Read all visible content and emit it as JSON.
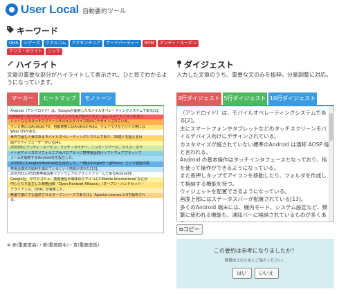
{
  "header": {
    "logo": "User Local",
    "subtitle": "自動要約ツール"
  },
  "keywords": {
    "title": "キーワード",
    "badges": [
      {
        "text": "OHA",
        "color": "blue"
      },
      {
        "text": "シアーズ",
        "color": "blue"
      },
      {
        "text": "クアルコム",
        "color": "blue"
      },
      {
        "text": "アクセンチュア",
        "color": "blue"
      },
      {
        "text": "サードパーティー",
        "color": "blue"
      },
      {
        "text": "ROM",
        "color": "red"
      },
      {
        "text": "アンディ・ルービン",
        "color": "red"
      },
      {
        "text": "クリス・ホワイト",
        "color": "red"
      },
      {
        "text": "ニック",
        "color": "red"
      }
    ]
  },
  "highlight": {
    "title": "ハイライト",
    "desc": "文章の重要な部分がハイライトして表示され、ひと目でわかるようになっています。",
    "tabs": [
      "マーカー",
      "ヒートマップ",
      "モノトーン"
    ],
    "lines": [
      {
        "text": "Android（アンドロイド）は、Googleが開発したモバイルオペレーティングシステムである[2]。",
        "bg": "#ffffff"
      },
      {
        "text": "Linuxカーネルやオープンソースソフトウェアがベースで、主にスマートフォンやタブ",
        "bg": "#ff5c5c"
      },
      {
        "text": "レットなどのタッチスクリーンモバイルデバイス向けにデザインされている。",
        "bg": "#ffb14d"
      },
      {
        "text": "テレビ用にはAndroid TV、自動車用にはAndroid Auto、ウェアラブルデバイス用には",
        "bg": "#ffe37a"
      },
      {
        "text": "Wear OSがある。",
        "bg": "#ffffff"
      },
      {
        "text": "世界で最も人気のあるモバイルオペレーティングシステムであり、20億人を超える月",
        "bg": "#ffd66b"
      },
      {
        "text": "間アクティブユーザーがいる[4]。",
        "bg": "#fff6a6"
      },
      {
        "text": "2003年にアンディ・ルービン、リッチ・マイナー、ニック・シアーズ、クリス・ホワ",
        "bg": "#cfe9a6"
      },
      {
        "text": "イトがアメリカカリフォルニア州パロアルトに携帯電話向けソフトウェアプラットフ",
        "bg": "#8fd0e8"
      },
      {
        "text": "ォームを開発するAndroid社を設立した。",
        "bg": "#a8dcf0"
      },
      {
        "text": "2005年にGoogleがAndroid社を買収した。一時はGoogleが「gPhone」という独自の携",
        "bg": "#64b0e8"
      },
      {
        "text": "帯電話端末の開発を進めているという憶測が流れた[13]。",
        "bg": "#c7e6f5"
      },
      {
        "text": "2007年11月5日携帯電話用ソフトウェアのプラットフォームであるAndroidを、",
        "bg": "#ffffff"
      },
      {
        "text": "Google社、タワクコミュ、技術通信半導体のクアルコムT-Mobile International などが",
        "bg": "#fff2a0"
      },
      {
        "text": "中心となり設立した規格団体「Open Handset Alliance」（オープン・ハンドセット・",
        "bg": "#ffe27a"
      },
      {
        "text": "アライアンス、OHA）が発表した。",
        "bg": "#fff0b0"
      },
      {
        "text": "無償で誰にでも提供されるオープンソースであり[2]、Apache License 2.0で配布され",
        "bg": "#ffd08a"
      },
      {
        "text": "る。",
        "bg": "#ffffff"
      }
    ]
  },
  "digest": {
    "title": "ダイジェスト",
    "desc": "入力した文章のうち、重要な文のみを抜粋。分量調整に対応。",
    "tabs": [
      "3行ダイジェスト",
      "5行ダイジェスト",
      "10行ダイジェスト"
    ],
    "lines": [
      "（アンドロイド）は、モバイルオペレーティングシステムである[2]。",
      "主にスマートフォンやタブレットなどのタッチスクリーンモバイルデバイス向けにデザインされている。",
      "カスタマイズが施されていない標準のAndroid は通称 AOSP 版と言われる。",
      "Android の基本操作はタッチインタフェースとなっており、指を使って操作ができるようになっている。",
      "また長押しタップでアイコンを移動したり、フォルダを作成して格納する機能を持つ。",
      "ウィジェットを配置できるようになっている。",
      "画面上部にはステータスバーが配置されている[13]。",
      "多くのAndroid 端末には、機内モード、システム設定など、頻繁に使われる機能も、通知バーに格納されているものが多くある。"
    ],
    "copy_label": "コピー"
  },
  "legend": "赤(重要度高)・黄(重要度中)・青(重要度低)",
  "feedback": {
    "question": "この要約は参考になりましたか？",
    "sub": "精度向上のためにご協力ください。",
    "yes": "はい",
    "no": "いいえ"
  },
  "colors": {
    "accent": "#1a73c8",
    "tab_red": "#e05b5b",
    "tab_green": "#4cb860",
    "tab_blue": "#3a9be0"
  }
}
